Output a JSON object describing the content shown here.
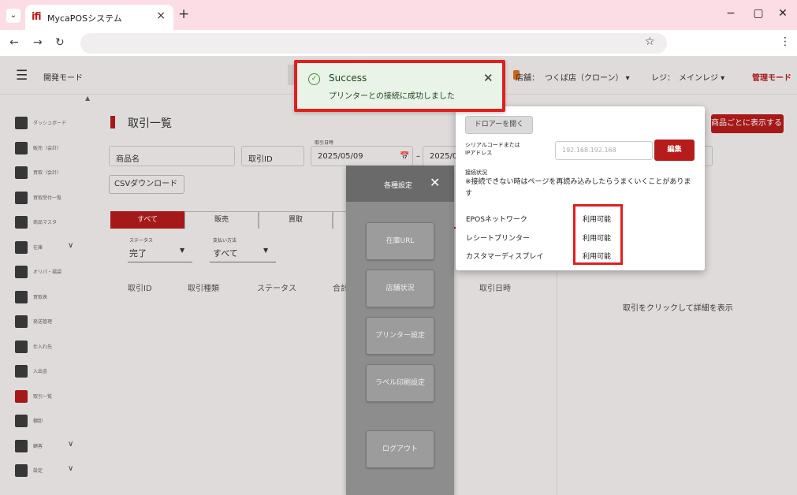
{
  "browser": {
    "tab_title": "MycaPOSシステム",
    "favicon": "ifi",
    "tab_close": "×",
    "new_tab": "+",
    "address": "",
    "minimize": "−",
    "maximize": "▢",
    "close": "✕"
  },
  "header": {
    "mode": "開発モード",
    "store_label": "店舗：",
    "store_value": "つくば店（クローン） ▾",
    "register_label": "レジ：",
    "register_value": "メインレジ ▾",
    "admin_mode": "管理モード"
  },
  "sidebar": {
    "items": [
      {
        "label": "ダッシュボード",
        "icon": "dashboard-icon",
        "active": false
      },
      {
        "label": "販売（会計）",
        "icon": "cart-icon",
        "active": false
      },
      {
        "label": "買取（会計）",
        "icon": "dollar-icon",
        "active": false
      },
      {
        "label": "買取受付一覧",
        "icon": "list-icon",
        "active": false
      },
      {
        "label": "商品マスタ",
        "icon": "store-icon",
        "active": false
      },
      {
        "label": "在庫",
        "icon": "box-icon",
        "active": false,
        "chevron": "∨"
      },
      {
        "label": "オリパ・福袋",
        "icon": "bag-icon",
        "active": false
      },
      {
        "label": "買取表",
        "icon": "table-icon",
        "active": false
      },
      {
        "label": "発送管理",
        "icon": "truck-icon",
        "active": false
      },
      {
        "label": "仕入れ先",
        "icon": "building-icon",
        "active": false
      },
      {
        "label": "入出金",
        "icon": "register-icon",
        "active": false
      },
      {
        "label": "取引一覧",
        "icon": "transaction-icon",
        "active": true
      },
      {
        "label": "棚卸",
        "icon": "check-icon",
        "active": false
      },
      {
        "label": "顧客",
        "icon": "people-icon",
        "active": false,
        "chevron": "∨"
      },
      {
        "label": "設定",
        "icon": "gear-icon",
        "active": false,
        "chevron": "∨"
      }
    ]
  },
  "main": {
    "title": "取引一覧",
    "per_product_button": "商品ごとに表示する",
    "product_name_label": "商品名",
    "transaction_id_label": "取引ID",
    "date_label": "取引日時",
    "date_from": "2025/05/09",
    "date_icon": "📅",
    "date_sep": "–",
    "date_to": "2025/05",
    "csv_button": "CSVダウンロード",
    "tabs": [
      "すべて",
      "販売",
      "買取",
      ""
    ],
    "status_label": "ステータス",
    "status_value": "完了",
    "payment_label": "支払い方法",
    "payment_value": "すべて",
    "columns": [
      "取引ID",
      "取引種類",
      "ステータス",
      "合計",
      "取引日時"
    ],
    "detail_hint": "取引をクリックして詳細を表示"
  },
  "settings": {
    "title": "各種設定",
    "close": "✕",
    "buttons": [
      "在庫URL",
      "店舗状況",
      "プリンター設定",
      "ラベル印刷設定",
      "ログアウト"
    ]
  },
  "printer": {
    "drawer_button": "ドロアーを開く",
    "address_label_1": "シリアルコードまたは",
    "address_label_2": "IPアドレス",
    "address_value": "192.168.192.168",
    "edit_button": "編集",
    "connection_label": "接続状況",
    "connection_note": "※接続できない時はページを再読み込みしたらうまくいくことがあります",
    "statuses": [
      {
        "name": "EPOSネットワーク",
        "value": "利用可能"
      },
      {
        "name": "レシートプリンター",
        "value": "利用可能"
      },
      {
        "name": "カスタマーディスプレイ",
        "value": "利用可能"
      }
    ]
  },
  "toast": {
    "title": "Success",
    "message": "プリンターとの接続に成功しました",
    "close": "✕"
  },
  "colors": {
    "brand": "#b71c1c",
    "highlight": "#e11f1f",
    "toast_bg": "#e9f3e7",
    "tabbar": "#fcdde5"
  }
}
